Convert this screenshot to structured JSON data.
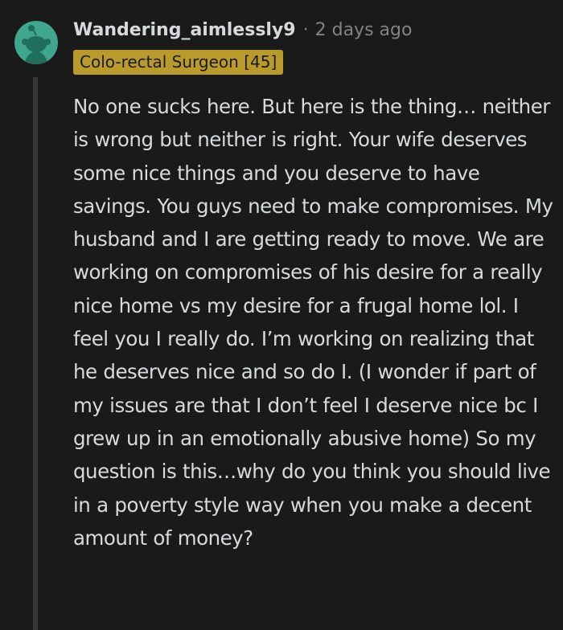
{
  "comment": {
    "author": "Wandering_aimlessly9",
    "separator": "·",
    "timestamp": "2 days ago",
    "flair": "Colo-rectal Surgeon [45]",
    "body": "No one sucks here. But here is the thing… neither is wrong but neither is right. Your wife deserves some nice things and you deserve to have savings. You guys need to make compromises. My husband and I are getting ready to move. We are working on compromises of his desire for a really nice home vs my desire for a frugal home lol. I feel you I really do. I’m working on realizing that he deserves nice and so do I. (I wonder if part of my issues are that I don’t feel I deserve nice bc I grew up in an emotionally abusive home) So my question is this…why do you think you should live in a poverty style way when you make a decent amount of money?"
  },
  "colors": {
    "background": "#1a1a1b",
    "text": "#d7dadc",
    "muted": "#818384",
    "flair_bg": "#b99b2c",
    "avatar_bg": "#3ea78e",
    "thread_line": "#343536"
  },
  "icons": {
    "avatar": "snoo-avatar-icon"
  }
}
